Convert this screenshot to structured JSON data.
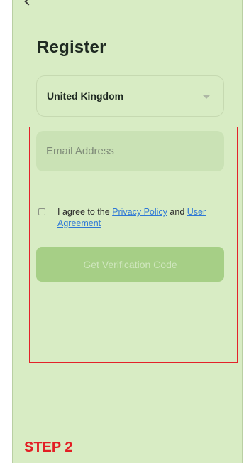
{
  "page": {
    "title": "Register",
    "step_label": "STEP 2"
  },
  "country": {
    "selected": "United Kingdom"
  },
  "email": {
    "placeholder": "Email Address",
    "value": ""
  },
  "agreement": {
    "prefix": "I agree to the ",
    "privacy_link": "Privacy Policy",
    "middle": " and ",
    "user_link": "User Agreement",
    "checked": false
  },
  "actions": {
    "get_code_label": "Get Verification Code"
  },
  "colors": {
    "background": "#d8ecc4",
    "primary_button_disabled": "#a6cf86",
    "link": "#2e78d6",
    "annotation_red": "#e31e24"
  },
  "icons": {
    "back": "back-arrow-icon",
    "dropdown": "chevron-down-icon"
  }
}
